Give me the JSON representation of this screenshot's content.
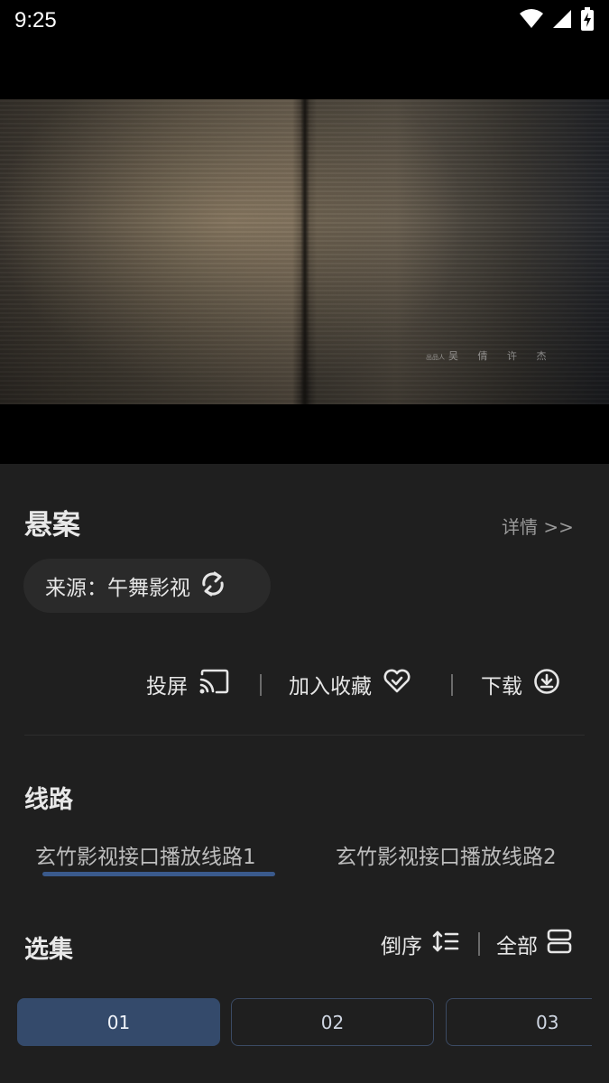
{
  "status_bar": {
    "time": "9:25",
    "icons": [
      "wifi-icon",
      "signal-icon",
      "battery-charging-icon"
    ]
  },
  "video": {
    "credit_small": "出品人",
    "credit_names": "吴 倩 许 杰"
  },
  "details": {
    "title": "悬案",
    "details_link": "详情 >>",
    "source_label": "来源：午舞影视",
    "source_icon": "refresh-icon"
  },
  "actions": [
    {
      "label": "投屏",
      "icon": "cast-icon"
    },
    {
      "label": "加入收藏",
      "icon": "heart-check-icon"
    },
    {
      "label": "下载",
      "icon": "download-icon"
    }
  ],
  "routes": {
    "title": "线路",
    "tabs": [
      "玄竹影视接口播放线路1",
      "玄竹影视接口播放线路2"
    ],
    "active_index": 0
  },
  "episodes": {
    "title": "选集",
    "sort_label": "倒序",
    "sort_icon": "sort-order-icon",
    "all_label": "全部",
    "all_icon": "list-rows-icon",
    "items": [
      "01",
      "02",
      "03"
    ],
    "active_index": 0
  },
  "colors": {
    "background": "#1f1f1f",
    "accent": "#344a6b",
    "underline": "#3a5a8c"
  }
}
